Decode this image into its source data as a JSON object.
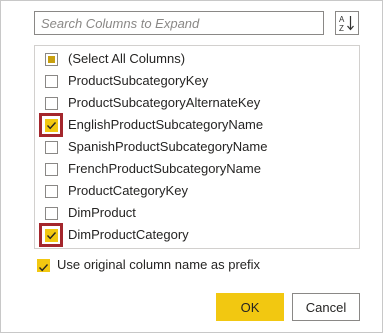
{
  "search": {
    "placeholder": "Search Columns to Expand",
    "value": ""
  },
  "sort_button": {
    "icon": "sort-az-icon",
    "letters_top": "A",
    "letters_bottom": "Z"
  },
  "columns": [
    {
      "label": "(Select All Columns)",
      "state": "partial",
      "highlighted": false
    },
    {
      "label": "ProductSubcategoryKey",
      "state": "unchecked",
      "highlighted": false
    },
    {
      "label": "ProductSubcategoryAlternateKey",
      "state": "unchecked",
      "highlighted": false
    },
    {
      "label": "EnglishProductSubcategoryName",
      "state": "checked",
      "highlighted": true
    },
    {
      "label": "SpanishProductSubcategoryName",
      "state": "unchecked",
      "highlighted": false
    },
    {
      "label": "FrenchProductSubcategoryName",
      "state": "unchecked",
      "highlighted": false
    },
    {
      "label": "ProductCategoryKey",
      "state": "unchecked",
      "highlighted": false
    },
    {
      "label": "DimProduct",
      "state": "unchecked",
      "highlighted": false
    },
    {
      "label": "DimProductCategory",
      "state": "checked",
      "highlighted": true
    }
  ],
  "prefix_option": {
    "label": "Use original column name as prefix",
    "checked": true
  },
  "buttons": {
    "ok": "OK",
    "cancel": "Cancel"
  },
  "colors": {
    "accent": "#f2c811",
    "highlight": "#a4262c",
    "border": "#8a8886"
  }
}
